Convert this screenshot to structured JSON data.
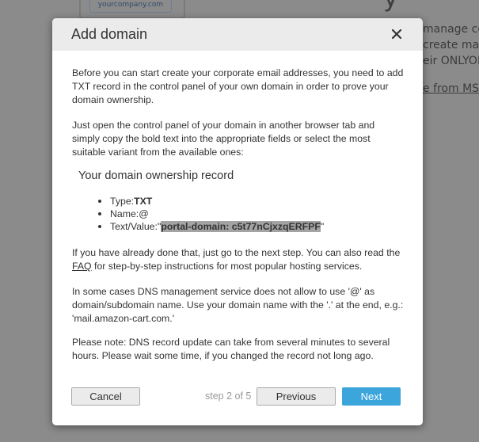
{
  "background": {
    "company_badge": "yourcompany.com",
    "heading_fragment": "y",
    "text_lines": [
      "manage cor",
      "create ma",
      "eir ONLYOF"
    ],
    "link_fragment": "e from MS"
  },
  "dialog": {
    "title": "Add domain",
    "intro": "Before you can start create your corporate email addresses, you need to add TXT record in the control panel of your own domain in order to prove your domain ownership.",
    "instructions": "Just open the control panel of your domain in another browser tab and simply copy the bold text into the appropriate fields or select the most suitable variant from the available ones:",
    "record_heading": "Your domain ownership record",
    "record": {
      "type_label": "Type:",
      "type_value": "TXT",
      "name_label": "Name:",
      "name_value": "@",
      "value_label": "Text/Value:",
      "value_quote_open": "\"",
      "value_value": "portal-domain: c5t77nCjxzqERFPF",
      "value_quote_close": "\""
    },
    "next_step_before": "If you have already done that, just go to the next step. You can also read the ",
    "faq_link": "FAQ",
    "next_step_after": " for step-by-step instructions for most popular hosting services.",
    "dns_note": "In some cases DNS management service does not allow to use '@' as domain/subdomain name. Use your domain name with the '.' at the end, e.g.: 'mail.amazon-cart.com.'",
    "update_note": "Please note: DNS record update can take from several minutes to several hours. Please wait some time, if you changed the record not long ago.",
    "step_indicator": "step 2 of 5",
    "buttons": {
      "cancel": "Cancel",
      "previous": "Previous",
      "next": "Next"
    }
  },
  "colors": {
    "overlay": "#8b8b8b",
    "header": "#ebebeb",
    "primary": "#3ba5dc",
    "highlight": "#a3a3a3"
  },
  "icons": {
    "close": "close-icon"
  }
}
